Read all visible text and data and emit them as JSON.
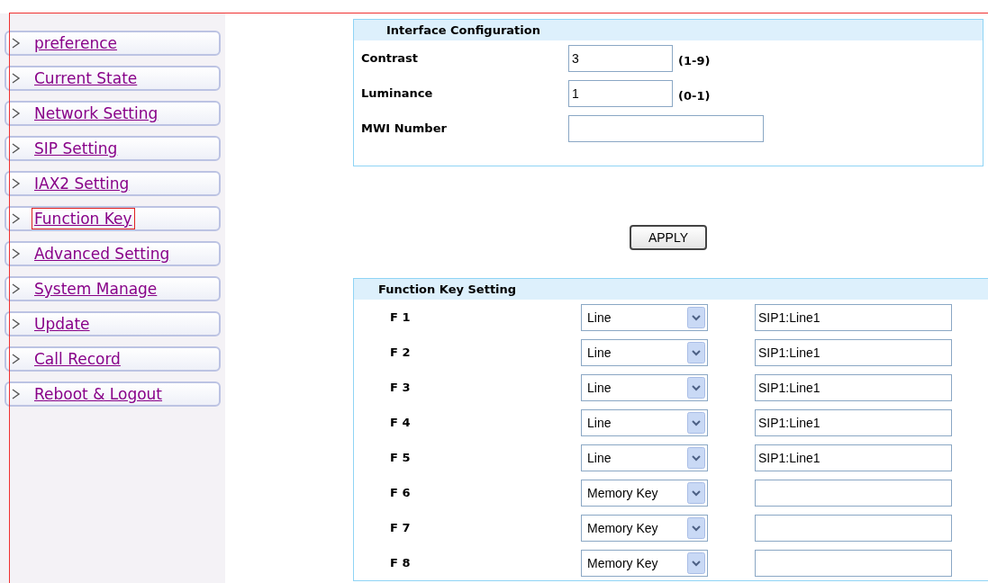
{
  "sidebar": {
    "items": [
      {
        "label": "preference",
        "highlighted": false
      },
      {
        "label": "Current State",
        "highlighted": false
      },
      {
        "label": "Network Setting",
        "highlighted": false
      },
      {
        "label": "SIP Setting",
        "highlighted": false
      },
      {
        "label": "IAX2 Setting",
        "highlighted": false
      },
      {
        "label": "Function Key",
        "highlighted": true
      },
      {
        "label": "Advanced Setting",
        "highlighted": false
      },
      {
        "label": "System Manage",
        "highlighted": false
      },
      {
        "label": "Update",
        "highlighted": false
      },
      {
        "label": "Call Record",
        "highlighted": false
      },
      {
        "label": "Reboot & Logout",
        "highlighted": false
      }
    ]
  },
  "interface_configuration": {
    "title": "Interface Configuration",
    "fields": [
      {
        "label": "Contrast",
        "value": "3",
        "range": "(1-9)",
        "kind": "short"
      },
      {
        "label": "Luminance",
        "value": "1",
        "range": "(0-1)",
        "kind": "short"
      },
      {
        "label": "MWI Number",
        "kind": "wide"
      }
    ]
  },
  "apply_button": "APPLY",
  "function_key_setting": {
    "title": "Function Key Setting",
    "rows": [
      {
        "key": "F 1",
        "type": "Line",
        "value": "SIP1:Line1"
      },
      {
        "key": "F 2",
        "type": "Line",
        "value": "SIP1:Line1"
      },
      {
        "key": "F 3",
        "type": "Line",
        "value": "SIP1:Line1"
      },
      {
        "key": "F 4",
        "type": "Line",
        "value": "SIP1:Line1"
      },
      {
        "key": "F 5",
        "type": "Line",
        "value": "SIP1:Line1"
      },
      {
        "key": "F 6",
        "type": "Memory Key"
      },
      {
        "key": "F 7",
        "type": "Memory Key"
      },
      {
        "key": "F 8",
        "type": "Memory Key"
      }
    ]
  }
}
